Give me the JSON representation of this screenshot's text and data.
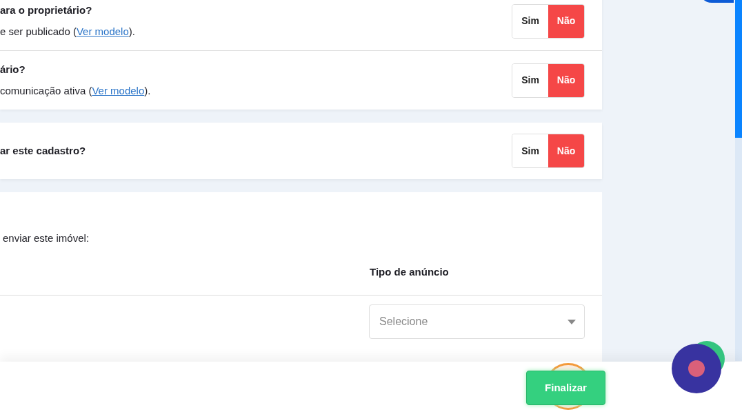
{
  "question_cards": [
    {
      "questions": [
        {
          "title": "ara o proprietário?",
          "description": {
            "before": "e ser publicado (",
            "link": "Ver modelo",
            "after": ")."
          },
          "options": [
            {
              "label": "Sim",
              "selected": false
            },
            {
              "label": "Não",
              "selected": true
            }
          ]
        },
        {
          "title": "ário?",
          "description": {
            "before": "comunicação ativa (",
            "link": "Ver modelo",
            "after": ")."
          },
          "options": [
            {
              "label": "Sim",
              "selected": false
            },
            {
              "label": "Não",
              "selected": true
            }
          ]
        }
      ]
    },
    {
      "questions": [
        {
          "title": "ar este cadastro?",
          "options": [
            {
              "label": "Sim",
              "selected": false
            },
            {
              "label": "Não",
              "selected": true
            }
          ]
        }
      ]
    }
  ],
  "portals": {
    "intro": "enviar este imóvel:",
    "columns": [
      "Tipo de anúncio"
    ],
    "select": {
      "placeholder": "Selecione"
    }
  },
  "footer": {
    "button": "Finalizar"
  }
}
